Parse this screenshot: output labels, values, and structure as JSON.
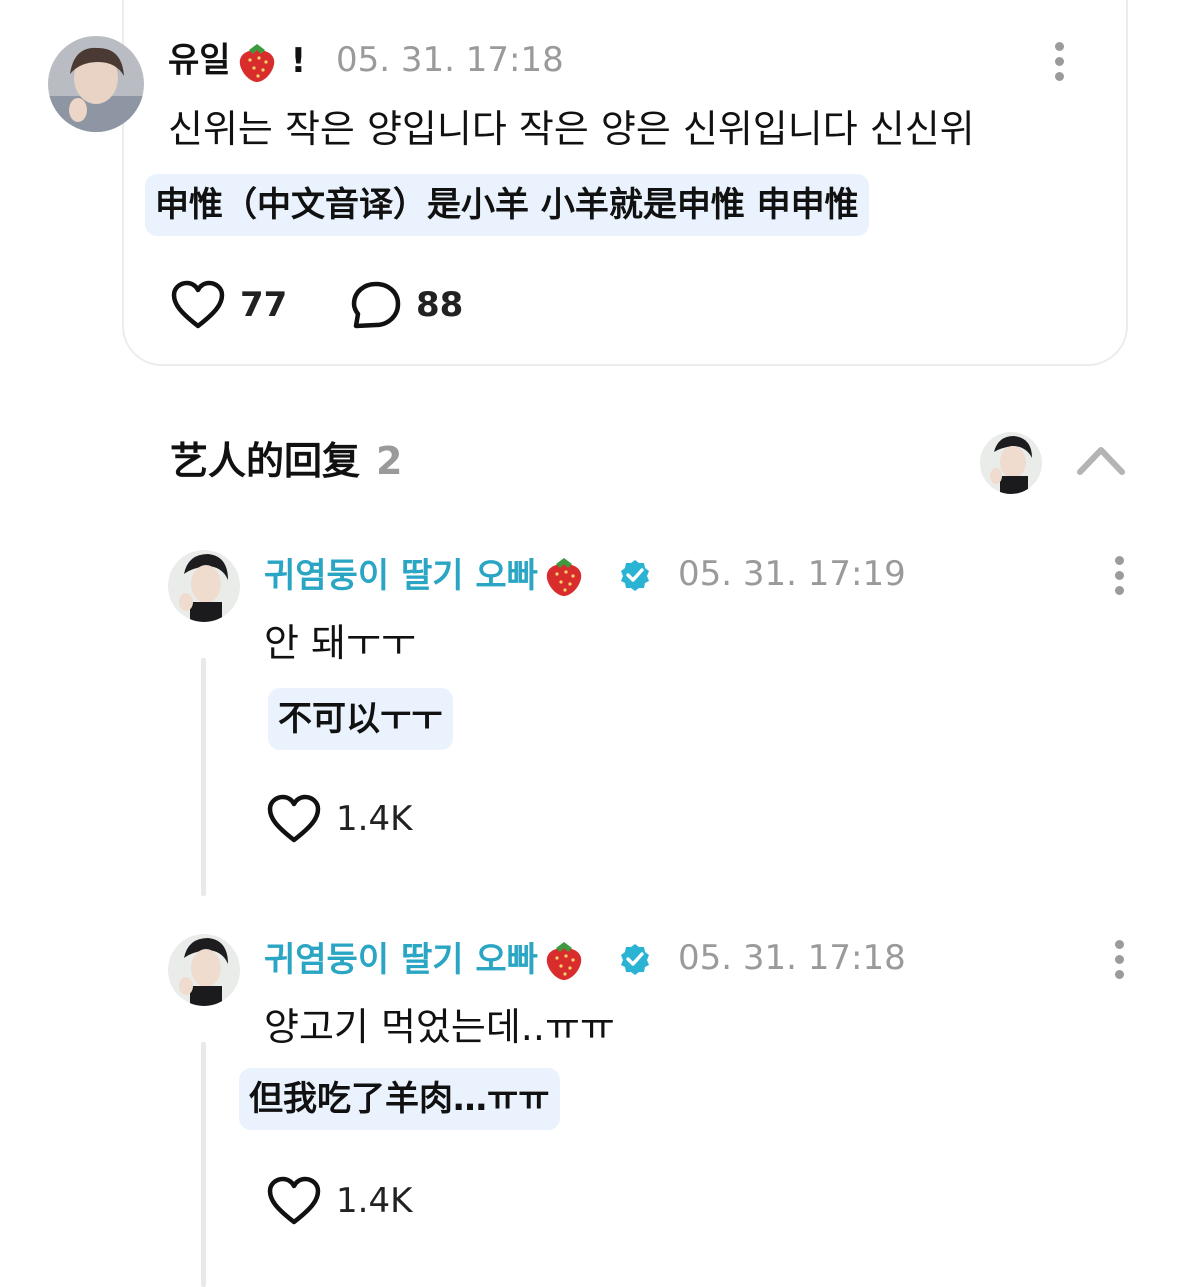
{
  "post": {
    "username": "유일",
    "username_suffix": "!",
    "timestamp": "05. 31. 17:18",
    "body": "신위는 작은 양입니다 작은 양은 신위입니다 신신위",
    "translation": "申惟（中文音译）是小羊 小羊就是申惟 申申惟",
    "likes": "77",
    "comments": "88"
  },
  "section": {
    "title": "艺人的回复",
    "count": "2"
  },
  "replies": [
    {
      "name": "귀염둥이 딸기 오빠",
      "timestamp": "05. 31. 17:19",
      "body": "안 돼ㅜㅜ",
      "translation": "不可以ㅜㅜ",
      "likes": "1.4K"
    },
    {
      "name": "귀염둥이 딸기 오빠",
      "timestamp": "05. 31. 17:18",
      "body": "양고기 먹었는데..ㅠㅠ",
      "translation": "但我吃了羊肉…ㅠㅠ",
      "likes": "1.4K"
    }
  ],
  "colors": {
    "artist_name": "#2aa5c4",
    "translation_bg": "#e9f2fd",
    "timestamp": "#9a9a9a",
    "verified": "#2ab3d3"
  },
  "icons": [
    "heart-icon",
    "comment-bubble-icon",
    "more-options-icon",
    "chevron-up-icon",
    "verified-badge-icon",
    "strawberry-emoji"
  ]
}
